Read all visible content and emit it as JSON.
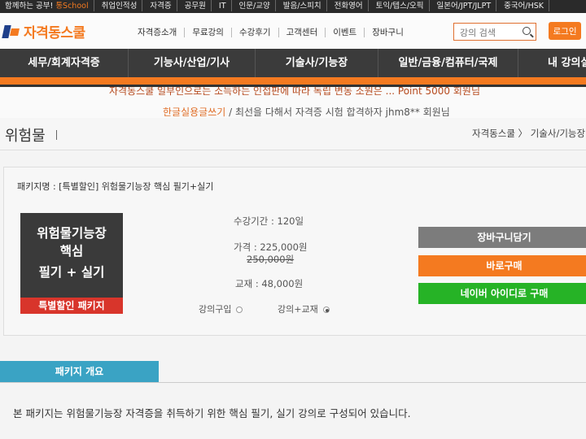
{
  "topbar": {
    "items": [
      {
        "prefix": "함께하는 공부!",
        "highlight": "통School"
      },
      {
        "label": "취업인적성"
      },
      {
        "label": "자격증"
      },
      {
        "label": "공무원"
      },
      {
        "label": "IT"
      },
      {
        "label": "인문/교양"
      },
      {
        "label": "발음/스피치"
      },
      {
        "label": "전화영어"
      },
      {
        "label": "토익/텝스/오픽"
      },
      {
        "label": "일본어/JPT/JLPT"
      },
      {
        "label": "중국어/HSK"
      }
    ]
  },
  "header": {
    "logo_text": "자격동스쿨",
    "nav": [
      "자격증소개",
      "무료강의",
      "수강후기",
      "고객센터",
      "이벤트",
      "장바구니"
    ],
    "search_placeholder": "강의 검색",
    "login_label": "로그인"
  },
  "mainnav": [
    "세무/회계자격증",
    "기능사/산업/기사",
    "기술사/기능장",
    "일반/금융/컴퓨터/국제",
    "내 강의실"
  ],
  "marquee": {
    "line1": "자격동스쿨 일부인으로는 소득하는 인접판에 따라 독립 변동 소원은 ... Point 5000 회원님",
    "line2_orange": "한글실용글쓰기",
    "line2_rest": " / 최선을 다해서 자격증 시험 합격하자 jhm8** 회원님"
  },
  "page": {
    "title": "위험물",
    "breadcrumb": "자격동스쿨 〉 기술사/기능장"
  },
  "package": {
    "name": "패키지명 : [특별할인] 위험물기능장 핵심 필기+실기",
    "thumb_line1": "위험물기능장",
    "thumb_line2": "핵심",
    "thumb_line3": "필기 + 실기",
    "thumb_tag": "특별할인 패키지",
    "period": "수강기간 : 120일",
    "price": "가격 : 225,000원",
    "original_price": "250,000원",
    "textbook": "교재 : 48,000원",
    "option_lecture": "강의구입",
    "option_lecture_book": "강의+교재",
    "selected_option": "강의+교재"
  },
  "buttons": {
    "cart": "장바구니담기",
    "buy": "바로구매",
    "naver": "네이버 아이디로 구매"
  },
  "colors": {
    "brand_orange": "#f47a20",
    "nav_dark": "#3b3b3b",
    "cart_gray": "#7c7c7c",
    "naver_green": "#26b326",
    "tab_blue": "#3aa3c4",
    "tag_red": "#d8352b"
  },
  "overview": {
    "tab_label": "패키지 개요",
    "description": "본 패키지는 위험물기능장 자격증을 취득하기 위한 핵심 필기, 실기 강의로 구성되어 있습니다."
  }
}
